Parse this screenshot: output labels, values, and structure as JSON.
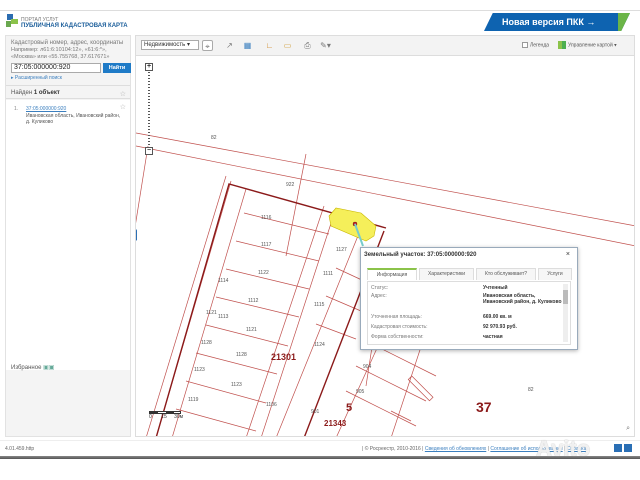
{
  "header": {
    "portal": "ПОРТАЛ УСЛУГ",
    "title": "ПУБЛИЧНАЯ КАДАСТРОВАЯ КАРТА",
    "new_version": "Новая версия ПКК →"
  },
  "sidebar": {
    "hint_title": "Кадастровый номер, адрес, координаты",
    "hint_example": "Например: л61:6:10104:12», «61:6:*», «Москва» или «55.755768, 37.617671»",
    "search_value": "37:05:000000:920",
    "search_button": "Найти",
    "advanced": "Расширенный поиск",
    "found_prefix": "Найден ",
    "found_count": "1 объект",
    "results": [
      {
        "num": "1.",
        "id": "37:05:000000:920",
        "address": "Ивановская область, Ивановский район, д. Куликово"
      }
    ],
    "favorites": "Избранное"
  },
  "toolbar": {
    "layer_select": "Недвижимость ▾",
    "legend": "Легенда",
    "map_control": "Управление картой ▾"
  },
  "map": {
    "labels": [
      "82",
      "922",
      "1116",
      "1117",
      "1122",
      "1112",
      "1121",
      "1121",
      "1128",
      "1128",
      "1123",
      "1123",
      "1119",
      "1127",
      "1111",
      "1115",
      "1124",
      "21301",
      "904",
      "905",
      "901",
      "21343",
      "5",
      "37",
      "82",
      "1114",
      "1113",
      "1106"
    ],
    "scale": [
      "0",
      "15",
      "30м"
    ]
  },
  "popup": {
    "title": "Земельный участок: 37:05:000000:920",
    "tabs": [
      "Информация",
      "Характеристики",
      "Кто обслуживает?",
      "Услуги"
    ],
    "rows": [
      {
        "label": "Статус:",
        "value": "Учтенный"
      },
      {
        "label": "Адрес:",
        "value": "Ивановская область, Ивановский район, д. Куликово"
      },
      {
        "label": "Уточненная площадь:",
        "value": "669.00 кв. м"
      },
      {
        "label": "Кадастровая стоимость:",
        "value": "92 970.93 руб."
      },
      {
        "label": "Форма собственности:",
        "value": "частная"
      }
    ]
  },
  "footer": {
    "version": "4.01.459.http",
    "copyright": "| © Росреестр, 2010-2016 |",
    "link1": "Сведения об обновлениях",
    "link2": "Соглашение об использовании",
    "link3": "Справка"
  },
  "watermark": "Avito",
  "colors": {
    "accent": "#0e63b0",
    "parcel": "#c0504d",
    "selected": "#f5ef5a"
  }
}
